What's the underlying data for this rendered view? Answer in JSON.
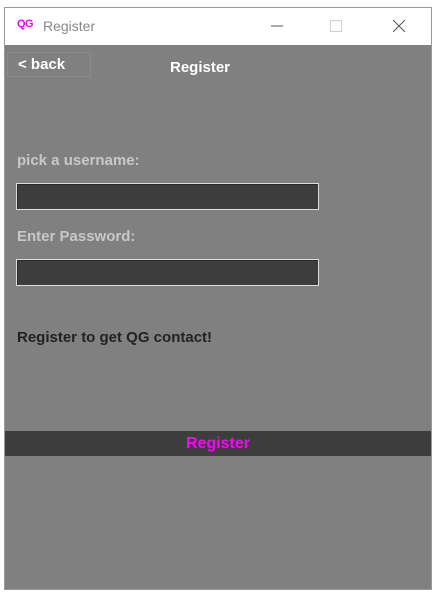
{
  "window": {
    "app_icon_text": "QG",
    "title": "Register"
  },
  "header": {
    "back_label": "< back",
    "title": "Register"
  },
  "form": {
    "username_label": "pick a username:",
    "username_value": "",
    "password_label": "Enter Password:",
    "password_value": ""
  },
  "info": {
    "message": "Register to get QG contact!"
  },
  "actions": {
    "register_label": "Register"
  },
  "colors": {
    "background": "#808080",
    "input_background": "#3d3d3d",
    "accent": "#ff00ff"
  }
}
